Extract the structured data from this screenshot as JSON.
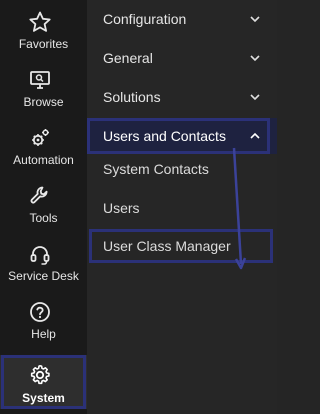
{
  "rail": {
    "items": [
      {
        "label": "Favorites",
        "icon": "star-icon"
      },
      {
        "label": "Browse",
        "icon": "monitor-search-icon"
      },
      {
        "label": "Automation",
        "icon": "gears-icon"
      },
      {
        "label": "Tools",
        "icon": "wrench-icon"
      },
      {
        "label": "Service Desk",
        "icon": "headset-icon"
      },
      {
        "label": "Help",
        "icon": "help-icon"
      },
      {
        "label": "System",
        "icon": "gear-icon",
        "active": true
      }
    ]
  },
  "menu": {
    "sections": [
      {
        "label": "Configuration",
        "icon": "chevron-down-icon"
      },
      {
        "label": "General",
        "icon": "chevron-down-icon"
      },
      {
        "label": "Solutions",
        "icon": "chevron-down-icon"
      },
      {
        "label": "Users and Contacts",
        "icon": "chevron-up-icon",
        "expanded": true
      }
    ],
    "sub_items": [
      {
        "label": "System Contacts"
      },
      {
        "label": "Users"
      },
      {
        "label": "User Class Manager",
        "highlighted": true
      }
    ]
  },
  "colors": {
    "rail_bg": "#1a1a1a",
    "panel_bg": "#262626",
    "highlight_border": "#2b3178",
    "text": "#e6e6e6"
  }
}
